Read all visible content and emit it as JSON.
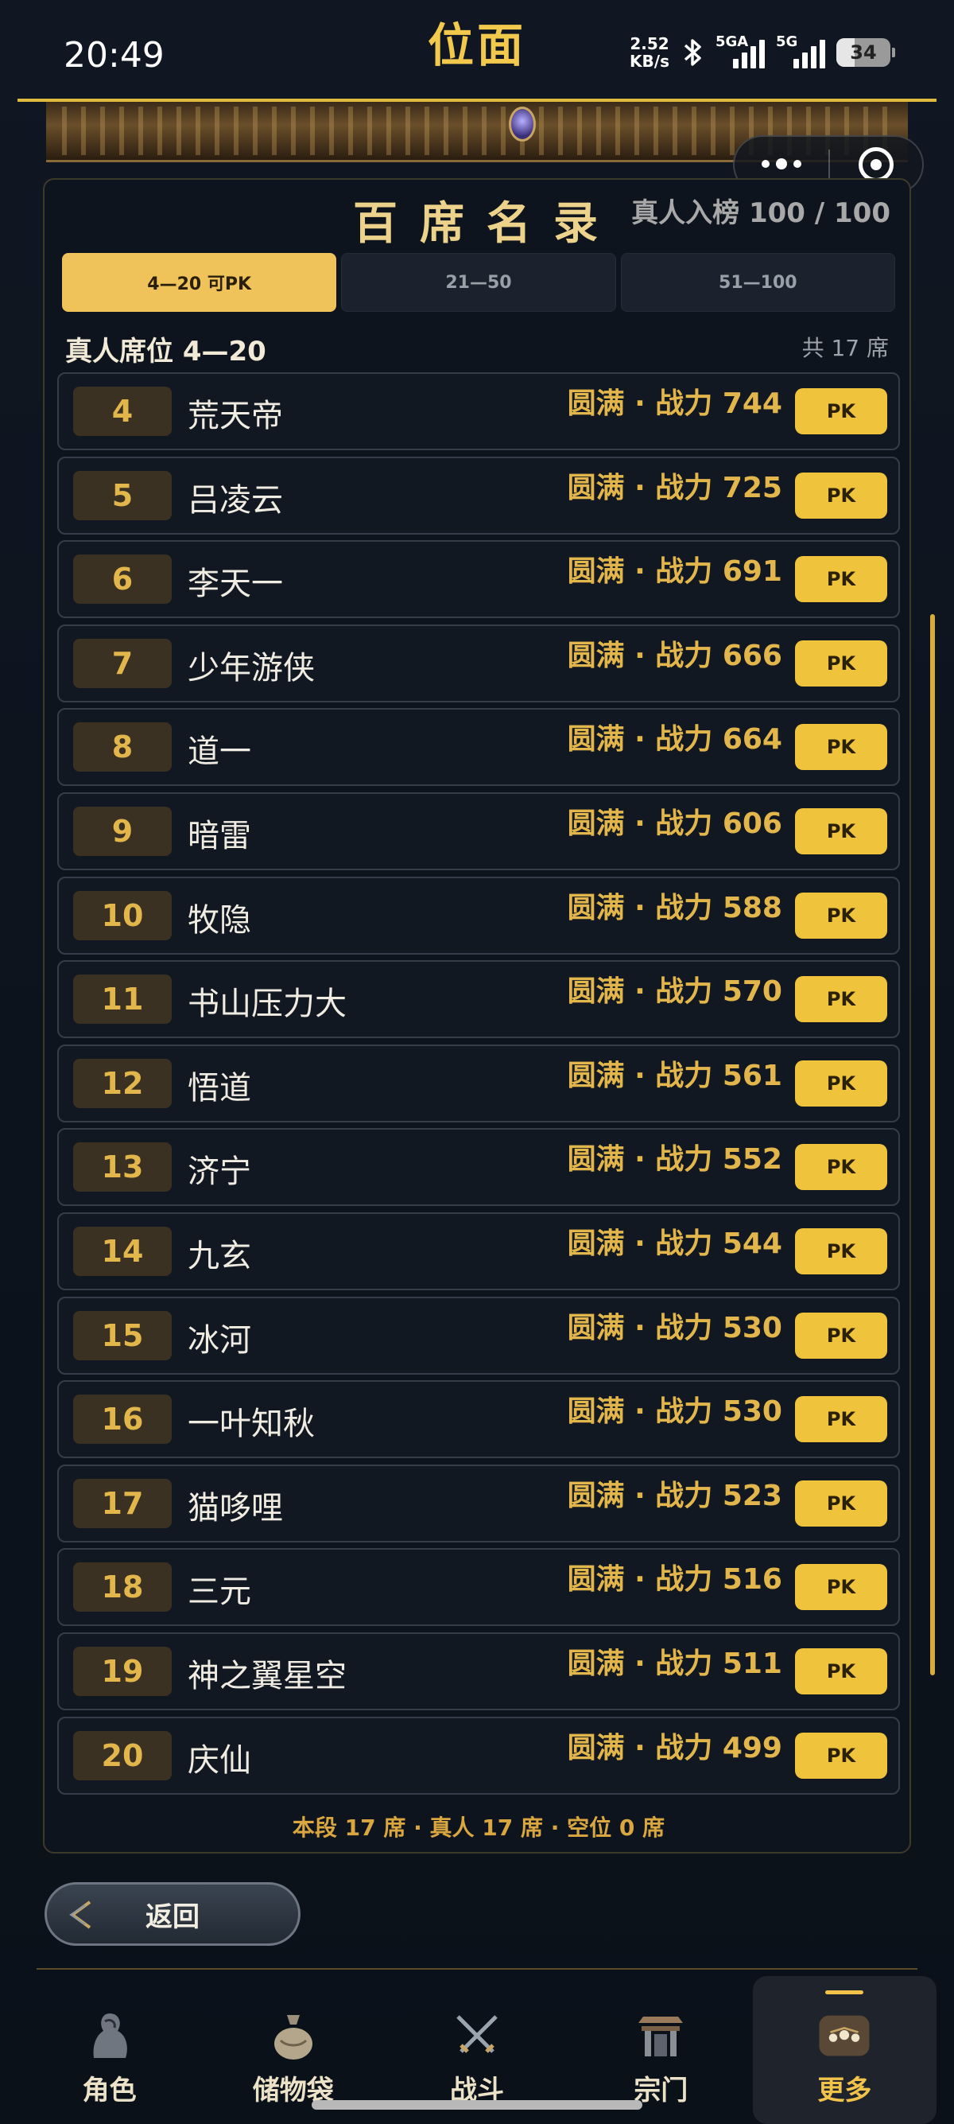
{
  "status": {
    "time": "20:49",
    "net_speed_value": "2.52",
    "net_speed_unit": "KB/s",
    "sim1": "5GA",
    "sim2": "5G",
    "battery": "34"
  },
  "header": {
    "title": "位面"
  },
  "panel": {
    "title": "百席名录",
    "count": "真人入榜 100 / 100",
    "tabs": [
      {
        "label": "4—20 可PK",
        "active": true
      },
      {
        "label": "21—50",
        "active": false
      },
      {
        "label": "51—100",
        "active": false
      }
    ],
    "section_title": "真人席位 4—20",
    "section_count": "共 17 席",
    "rows": [
      {
        "rank": "4",
        "name": "荒天帝",
        "power": "圆满 · 战力 744",
        "pk": "PK"
      },
      {
        "rank": "5",
        "name": "吕凌云",
        "power": "圆满 · 战力 725",
        "pk": "PK"
      },
      {
        "rank": "6",
        "name": "李天一",
        "power": "圆满 · 战力 691",
        "pk": "PK"
      },
      {
        "rank": "7",
        "name": "少年游侠",
        "power": "圆满 · 战力 666",
        "pk": "PK"
      },
      {
        "rank": "8",
        "name": "道一",
        "power": "圆满 · 战力 664",
        "pk": "PK"
      },
      {
        "rank": "9",
        "name": "暗雷",
        "power": "圆满 · 战力 606",
        "pk": "PK"
      },
      {
        "rank": "10",
        "name": "牧隐",
        "power": "圆满 · 战力 588",
        "pk": "PK"
      },
      {
        "rank": "11",
        "name": "书山压力大",
        "power": "圆满 · 战力 570",
        "pk": "PK"
      },
      {
        "rank": "12",
        "name": "悟道",
        "power": "圆满 · 战力 561",
        "pk": "PK"
      },
      {
        "rank": "13",
        "name": "济宁",
        "power": "圆满 · 战力 552",
        "pk": "PK"
      },
      {
        "rank": "14",
        "name": "九玄",
        "power": "圆满 · 战力 544",
        "pk": "PK"
      },
      {
        "rank": "15",
        "name": "冰河",
        "power": "圆满 · 战力 530",
        "pk": "PK"
      },
      {
        "rank": "16",
        "name": "一叶知秋",
        "power": "圆满 · 战力 530",
        "pk": "PK"
      },
      {
        "rank": "17",
        "name": "猫哆哩",
        "power": "圆满 · 战力 523",
        "pk": "PK"
      },
      {
        "rank": "18",
        "name": "三元",
        "power": "圆满 · 战力 516",
        "pk": "PK"
      },
      {
        "rank": "19",
        "name": "神之翼星空",
        "power": "圆满 · 战力 511",
        "pk": "PK"
      },
      {
        "rank": "20",
        "name": "庆仙",
        "power": "圆满 · 战力 499",
        "pk": "PK"
      }
    ],
    "footer": "本段 17 席 · 真人 17 席 · 空位 0 席"
  },
  "back_button": {
    "label": "返回"
  },
  "nav": [
    {
      "label": "角色",
      "icon": "character-icon",
      "active": false
    },
    {
      "label": "储物袋",
      "icon": "storage-bag-icon",
      "active": false
    },
    {
      "label": "战斗",
      "icon": "crossed-swords-icon",
      "active": false
    },
    {
      "label": "宗门",
      "icon": "sect-gate-icon",
      "active": false
    },
    {
      "label": "更多",
      "icon": "more-icon",
      "active": true
    }
  ],
  "colors": {
    "accent": "#efc43c",
    "rank_text": "#e3b64c",
    "background": "#0e141d"
  }
}
